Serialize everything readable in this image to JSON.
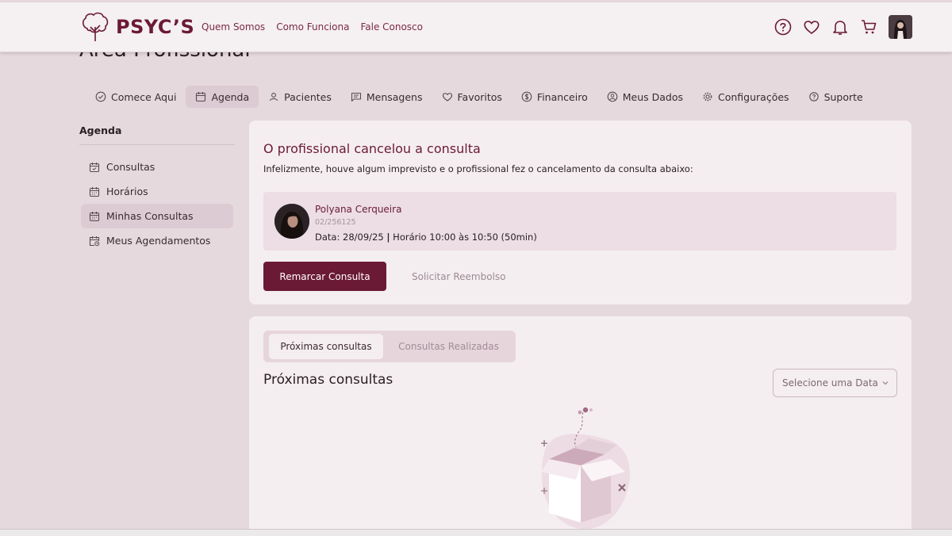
{
  "brand": {
    "name": "PSYC’S",
    "color": "#6b1a36"
  },
  "topnav": [
    "Quem Somos",
    "Como Funciona",
    "Fale Conosco"
  ],
  "header_icons": [
    "help-icon",
    "heart-icon",
    "bell-icon",
    "cart-icon"
  ],
  "page": {
    "title": "Área Profissional"
  },
  "tabs": [
    {
      "label": "Comece Aqui",
      "icon": "check-circle-icon"
    },
    {
      "label": "Agenda",
      "icon": "calendar-icon",
      "active": true
    },
    {
      "label": "Pacientes",
      "icon": "user-icon"
    },
    {
      "label": "Mensagens",
      "icon": "message-icon"
    },
    {
      "label": "Favoritos",
      "icon": "heart-icon"
    },
    {
      "label": "Financeiro",
      "icon": "dollar-icon"
    },
    {
      "label": "Meus Dados",
      "icon": "user-circle-icon"
    },
    {
      "label": "Configurações",
      "icon": "gear-icon"
    },
    {
      "label": "Suporte",
      "icon": "help-icon"
    }
  ],
  "sidebar": {
    "title": "Agenda",
    "items": [
      {
        "label": "Consultas"
      },
      {
        "label": "Horários"
      },
      {
        "label": "Minhas Consultas",
        "active": true
      },
      {
        "label": "Meus Agendamentos"
      }
    ]
  },
  "cancel_notice": {
    "title": "O profissional cancelou a consulta",
    "description": "Infelizmente, houve algum imprevisto e o profissional fez o cancelamento da consulta abaixo:",
    "professional": {
      "name": "Polyana Cerqueira",
      "registration": "02/256125",
      "date_label": "Data:",
      "date": "28/09/25",
      "separator": "|",
      "time_label": "Horário",
      "time": "10:00 às 10:50 (50min)"
    },
    "primary_button": "Remarcar Consulta",
    "secondary_button": "Solicitar Reembolso"
  },
  "appointments": {
    "tabs": [
      "Próximas consultas",
      "Consultas Realizadas"
    ],
    "active_tab": "Próximas consultas",
    "section_title": "Próximas consultas",
    "date_select_placeholder": "Selecione uma Data"
  },
  "colors": {
    "accent": "#6b1a36",
    "background": "#e6d9de",
    "card": "#f5eef1",
    "active_tab": "#dccbd2"
  }
}
